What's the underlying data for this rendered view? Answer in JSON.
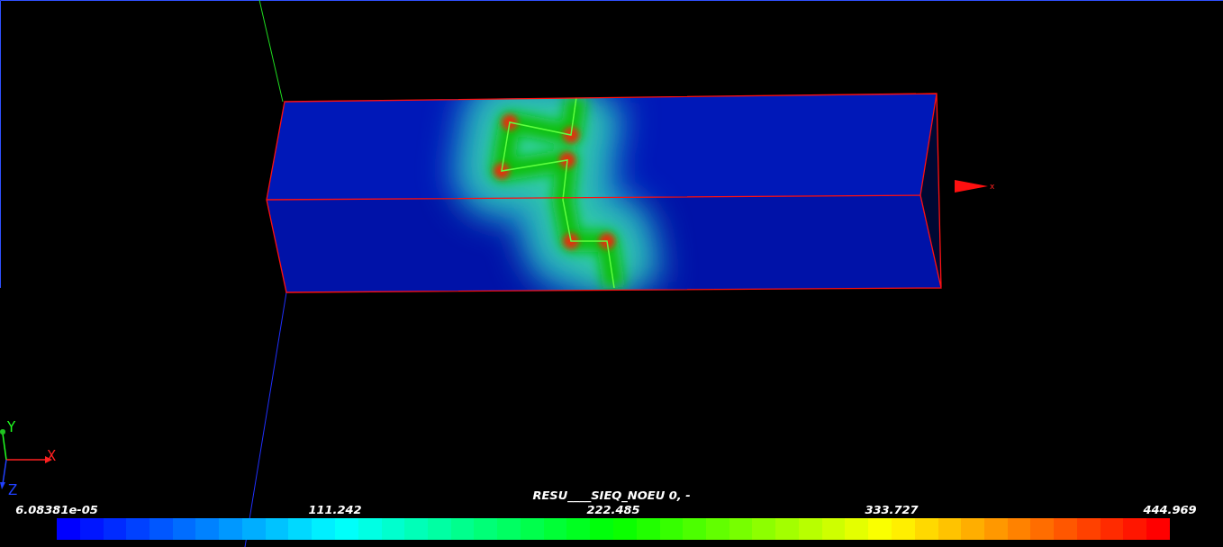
{
  "scene": {
    "axis_label": "x"
  },
  "orientation_axes": {
    "labels": [
      {
        "kind": "y",
        "text": "Y"
      },
      {
        "kind": "x",
        "text": "X"
      },
      {
        "kind": "z",
        "text": "Z"
      }
    ]
  },
  "scalar_bar": {
    "title": "RESU____SIEQ_NOEU 0, -",
    "tick_labels": [
      "6.08381e-05",
      "111.242",
      "222.485",
      "333.727",
      "444.969"
    ]
  }
}
